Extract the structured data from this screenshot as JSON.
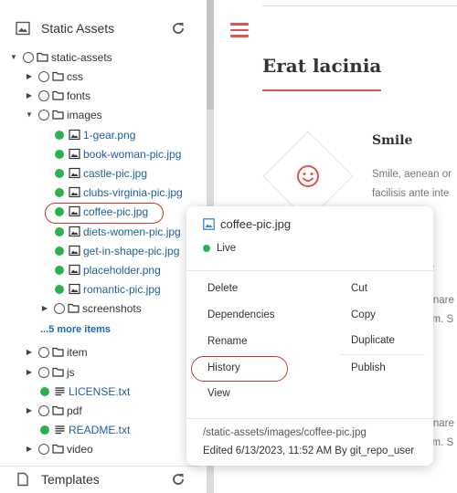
{
  "sidebar": {
    "header": {
      "title": "Static Assets",
      "icon": "image-icon",
      "refresh_icon": "refresh-icon"
    },
    "footer": {
      "title": "Templates",
      "icon": "template-icon",
      "refresh_icon": "refresh-icon"
    },
    "tree": [
      {
        "label": "static-assets",
        "type": "folder",
        "expanded": true,
        "selection": "radio",
        "level": 0
      },
      {
        "label": "css",
        "type": "folder",
        "expanded": false,
        "selection": "radio",
        "level": 1
      },
      {
        "label": "fonts",
        "type": "folder",
        "expanded": false,
        "selection": "radio",
        "level": 1
      },
      {
        "label": "images",
        "type": "folder",
        "expanded": true,
        "selection": "radio",
        "level": 1
      },
      {
        "label": "1-gear.png",
        "type": "image",
        "status": "live",
        "level": 2
      },
      {
        "label": "book-woman-pic.jpg",
        "type": "image",
        "status": "live",
        "level": 2
      },
      {
        "label": "castle-pic.jpg",
        "type": "image",
        "status": "live",
        "level": 2
      },
      {
        "label": "clubs-virginia-pic.jpg",
        "type": "image",
        "status": "live",
        "level": 2
      },
      {
        "label": "coffee-pic.jpg",
        "type": "image",
        "status": "live",
        "level": 2,
        "highlighted": true
      },
      {
        "label": "diets-women-pic.jpg",
        "type": "image",
        "status": "live",
        "level": 2
      },
      {
        "label": "get-in-shape-pic.jpg",
        "type": "image",
        "status": "live",
        "level": 2
      },
      {
        "label": "placeholder.png",
        "type": "image",
        "status": "live",
        "level": 2
      },
      {
        "label": "romantic-pic.jpg",
        "type": "image",
        "status": "live",
        "level": 2
      },
      {
        "label": "screenshots",
        "type": "folder",
        "expanded": false,
        "selection": "radio",
        "level": 2
      },
      {
        "label": "...5 more items",
        "type": "more",
        "level": 1
      },
      {
        "label": "item",
        "type": "folder",
        "expanded": false,
        "selection": "radio",
        "level": 1
      },
      {
        "label": "js",
        "type": "folder",
        "expanded": false,
        "selection": "radio",
        "level": 1
      },
      {
        "label": "LICENSE.txt",
        "type": "text",
        "status": "live",
        "level": 1
      },
      {
        "label": "pdf",
        "type": "folder",
        "expanded": false,
        "selection": "radio",
        "level": 1
      },
      {
        "label": "README.txt",
        "type": "text",
        "status": "live",
        "level": 1
      },
      {
        "label": "video",
        "type": "folder",
        "expanded": false,
        "selection": "radio",
        "level": 1
      }
    ]
  },
  "page": {
    "title": "Erat lacinia",
    "feature_title": "Smile",
    "feature_text": [
      "Smile, aenean or",
      "facilisis ante inte"
    ],
    "fragments": [
      "d",
      "rnare",
      "im. S",
      "rnare",
      "im. S"
    ],
    "icon": "smile-icon",
    "menu_icon": "hamburger-icon"
  },
  "popover": {
    "file_name": "coffee-pic.jpg",
    "status": "Live",
    "actions_left": [
      "Delete",
      "Dependencies",
      "Rename",
      "History",
      "View"
    ],
    "actions_right": [
      "Cut",
      "Copy",
      "Duplicate",
      "Publish"
    ],
    "path": "/static-assets/images/coffee-pic.jpg",
    "edited": "Edited 6/13/2023, 11:52 AM By git_repo_user"
  },
  "colors": {
    "accent": "#e05252",
    "live": "#2bb24c",
    "link": "#1f5e9b",
    "highlight_ring": "#cc3b2f"
  }
}
